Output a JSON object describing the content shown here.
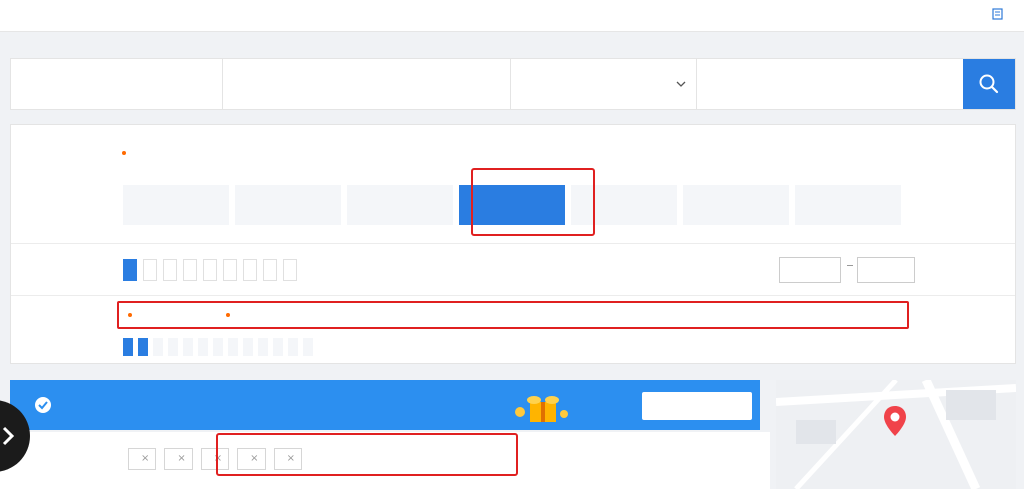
{
  "topnav": {
    "tabs": [
      "",
      "",
      "",
      ""
    ],
    "order": ""
  },
  "search": {
    "destination": {
      "label": "",
      "value": ""
    },
    "checkin": {
      "label": "",
      "value": ""
    },
    "nights": "",
    "checkout": {
      "label": "",
      "value": ""
    },
    "rooms": {
      "label": "",
      "value": ""
    },
    "keyword": {
      "label": "",
      "placeholder": ""
    }
  },
  "filter": {
    "location": {
      "title": "",
      "tabs": [
        "",
        "",
        "",
        ""
      ],
      "areas": [
        {
          "name": "",
          "pct": ""
        },
        {
          "name": "",
          "pct": ""
        },
        {
          "name": "",
          "pct": ""
        },
        {
          "name": "",
          "pct": ""
        },
        {
          "name": "",
          "pct": ""
        },
        {
          "name": "",
          "pct": ""
        },
        {
          "name": "",
          "pct": ""
        }
      ],
      "more": ""
    },
    "star": {
      "title": "",
      "options": [
        "",
        "",
        "",
        "",
        "",
        "",
        "",
        "",
        "",
        ""
      ],
      "min_placeholder": "",
      "max_placeholder": ""
    },
    "advanced": {
      "title": "",
      "options": [
        "",
        "",
        "",
        "",
        "",
        "",
        "",
        "",
        "",
        "",
        "",
        ""
      ],
      "tags": [
        "",
        "",
        "",
        "",
        "",
        "",
        "",
        "",
        "",
        "",
        "",
        "",
        "",
        "",
        ""
      ],
      "more": ""
    }
  },
  "banner": {
    "text": "",
    "button": ""
  },
  "results": {
    "count": "",
    "chips": [
      "",
      "",
      "",
      "",
      ""
    ],
    "clear": ""
  },
  "map": {
    "label": ""
  },
  "colors": {
    "accent": "#2a7de1",
    "highlight": "#e02020",
    "orange": "#ff7a00"
  }
}
